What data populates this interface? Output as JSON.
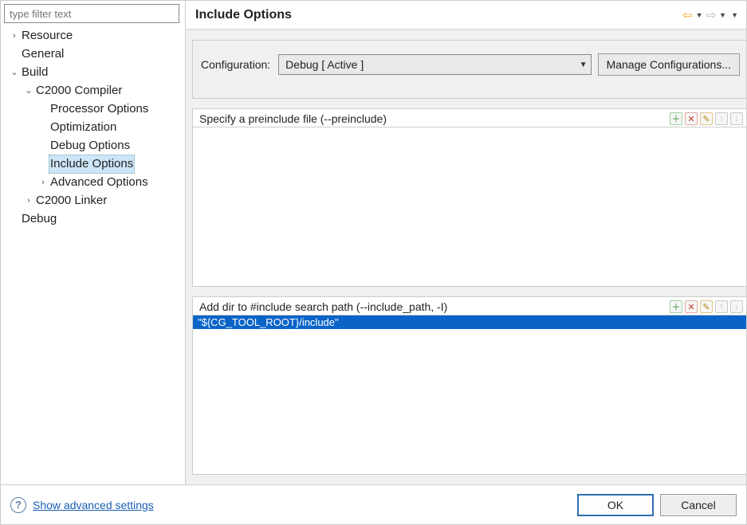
{
  "sidebar": {
    "filter_placeholder": "type filter text",
    "items": [
      {
        "label": "Resource",
        "indent": 0,
        "twisty": "collapsed"
      },
      {
        "label": "General",
        "indent": 0,
        "twisty": "none"
      },
      {
        "label": "Build",
        "indent": 0,
        "twisty": "expanded"
      },
      {
        "label": "C2000 Compiler",
        "indent": 1,
        "twisty": "expanded"
      },
      {
        "label": "Processor Options",
        "indent": 2,
        "twisty": "none"
      },
      {
        "label": "Optimization",
        "indent": 2,
        "twisty": "none"
      },
      {
        "label": "Debug Options",
        "indent": 2,
        "twisty": "none"
      },
      {
        "label": "Include Options",
        "indent": 2,
        "twisty": "none",
        "selected": true
      },
      {
        "label": "Advanced Options",
        "indent": 2,
        "twisty": "collapsed"
      },
      {
        "label": "C2000 Linker",
        "indent": 1,
        "twisty": "collapsed"
      },
      {
        "label": "Debug",
        "indent": 0,
        "twisty": "none"
      }
    ]
  },
  "header": {
    "title": "Include Options"
  },
  "config": {
    "label": "Configuration:",
    "value": "Debug  [ Active ]",
    "manage_label": "Manage Configurations..."
  },
  "panels": [
    {
      "title": "Specify a preinclude file (--preinclude)",
      "entries": []
    },
    {
      "title": "Add dir to #include search path (--include_path, -I)",
      "entries": [
        {
          "text": "\"${CG_TOOL_ROOT}/include\"",
          "selected": true
        }
      ]
    }
  ],
  "footer": {
    "advanced_label": "Show advanced settings",
    "ok_label": "OK",
    "cancel_label": "Cancel"
  }
}
